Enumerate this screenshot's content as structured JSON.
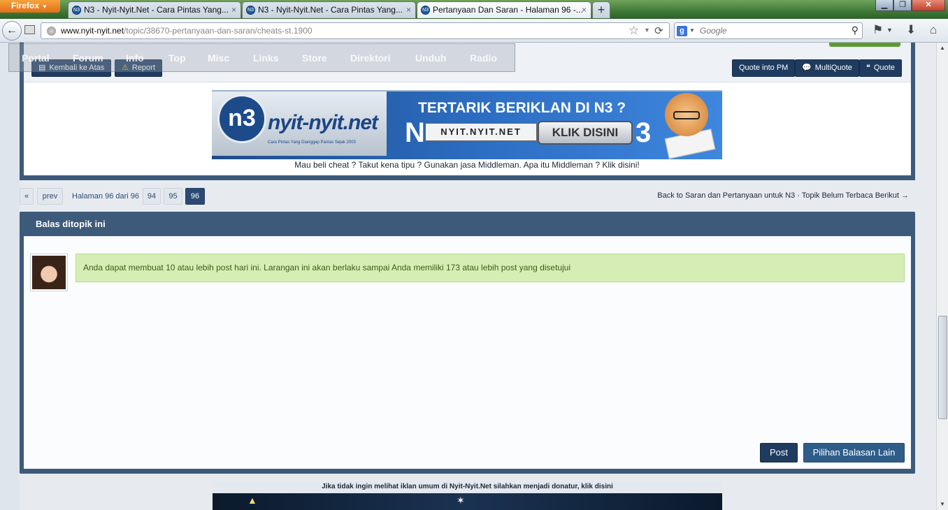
{
  "browser": {
    "menu_label": "Firefox",
    "tabs": [
      {
        "title": "N3 - Nyit-Nyit.Net - Cara Pintas Yang...",
        "active": false
      },
      {
        "title": "N3 - Nyit-Nyit.Net - Cara Pintas Yang...",
        "active": false
      },
      {
        "title": "Pertanyaan Dan Saran - Halaman 96 -...",
        "active": true
      }
    ],
    "new_tab": "+",
    "url_domain": "www.nyit-nyit.net",
    "url_path": "/topic/38670-pertanyaan-dan-saran/cheats-st.1900",
    "search_engine": "Google",
    "search_placeholder": "Google"
  },
  "site_nav": {
    "items": [
      "Portal",
      "Forum",
      "Info",
      "Top",
      "Misc",
      "Links",
      "Store",
      "Direktori",
      "Unduh",
      "Radio"
    ]
  },
  "post_controls": {
    "back_to_top": "Kembali ke Atas",
    "report": "Report",
    "quote_pm": "Quote into PM",
    "multiquote": "MultiQuote",
    "quote": "Quote"
  },
  "banner": {
    "logo": "nyit-nyit.net",
    "logo_sub": "Cara Pintas Yang Dianggap Pantas Sejak 2003",
    "headline": "TERTARIK BERIKLAN DI N3 ?",
    "address": "NYIT.NYIT.NET",
    "cta": "KLIK DISINI",
    "n_letter": "N",
    "three": "3"
  },
  "middleman": {
    "text": "Mau beli cheat ? Takut kena tipu ? Gunakan jasa Middleman. Apa itu Middleman ? ",
    "link": "Klik disini!"
  },
  "pagination": {
    "first": "«",
    "prev": "prev",
    "label": "Halaman 96 dari 96",
    "pages": [
      "94",
      "95",
      "96"
    ],
    "current": "96",
    "back_link": "Back to Saran dan Pertanyaan untuk N3",
    "separator": "·",
    "next_topic": "Topik Belum Terbaca Berikut →"
  },
  "reply": {
    "title": "Balas ditopik ini",
    "notice": "Anda dapat membuat 10 atau lebih post hari ini. Larangan ini akan berlaku sampai Anda memiliki 173 atau lebih post yang disetujui",
    "post_button": "Post",
    "more_button": "Pilihan Balasan Lain"
  },
  "ad_footer": {
    "text": "Jika tidak ingin melihat iklan umum di Nyit-Nyit.Net silahkan menjadi donatur, klik disini"
  }
}
